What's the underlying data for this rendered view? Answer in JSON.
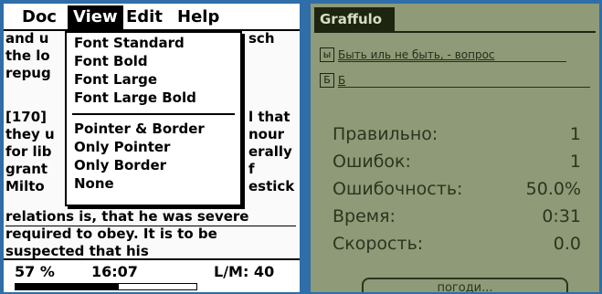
{
  "left": {
    "menubar": {
      "items": [
        "Doc",
        "View",
        "Edit",
        "Help"
      ]
    },
    "text_lines": [
      "and u",
      "the lo",
      "repug",
      "[170]",
      "they u",
      "for lib",
      "grant",
      "Milto",
      "relations is, that he was severe",
      "required to obey. It is to be",
      "suspected that his"
    ],
    "right_fragments": [
      "sch",
      "",
      "",
      "l that",
      "nour",
      "erally",
      "f",
      "estick"
    ],
    "view_menu": {
      "items": [
        "Font Standard",
        "Font Bold",
        "Font Large",
        "Font Large Bold",
        "Pointer & Border",
        "Only Pointer",
        "Only Border",
        "None"
      ]
    },
    "status": {
      "percent": "57 %",
      "time": "16:07",
      "lm": "L/M: 40",
      "progress_fraction": 0.57
    }
  },
  "right": {
    "title": "Graffulo",
    "fields": [
      {
        "badge": "ы",
        "text": "Быть иль не быть, - вопрос"
      },
      {
        "badge": "Б",
        "text": "Б"
      }
    ],
    "stats": [
      {
        "label": "Правильно:",
        "value": "1"
      },
      {
        "label": "Ошибок:",
        "value": "1"
      },
      {
        "label": "Ошибочность:",
        "value": "50.0%"
      },
      {
        "label": "Время:",
        "value": "0:31"
      },
      {
        "label": "Скорость:",
        "value": "0.0"
      }
    ],
    "wait_button": "погоди..."
  }
}
